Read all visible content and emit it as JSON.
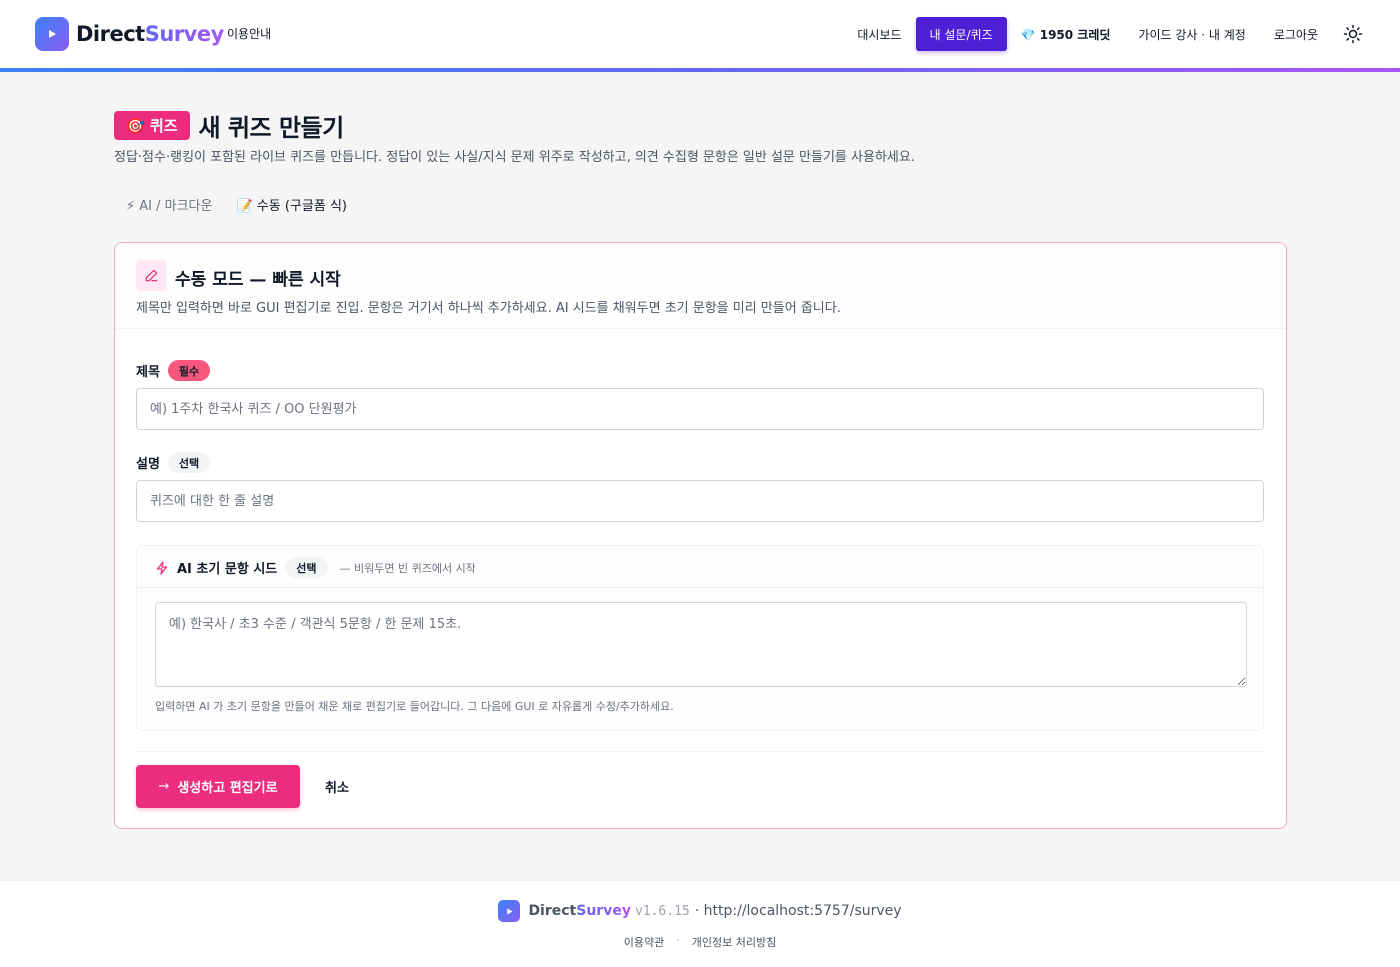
{
  "header": {
    "brand_part1": "Direct",
    "brand_part2": "Survey",
    "guide_link": "이용안내",
    "nav": {
      "dashboard": "대시보드",
      "my_surveys": "내 설문/퀴즈",
      "credits": "💎 1950 크레딧",
      "account": "가이드 강사 · 내 계정",
      "logout": "로그아웃"
    },
    "theme_icon": "sun-icon",
    "accent_color": "#4f1fd6"
  },
  "page": {
    "badge": "🎯 퀴즈",
    "title": "새 퀴즈 만들기",
    "description": "정답·점수·랭킹이 포함된 라이브 퀴즈를 만듭니다. 정답이 있는 사실/지식 문제 위주로 작성하고, 의견 수집형 문항은 일반 설문 만들기를 사용하세요.",
    "badge_color": "#ec2d7f"
  },
  "mode_tabs": {
    "ai": "⚡ AI / 마크다운",
    "manual": "📝 수동 (구글폼 식)"
  },
  "card": {
    "icon": "pencil-icon",
    "title": "수동 모드 — 빠른 시작",
    "description": "제목만 입력하면 바로 GUI 편집기로 진입. 문항은 거기서 하나씩 추가하세요. AI 시드를 채워두면 초기 문항을 미리 만들어 줍니다.",
    "title_field": {
      "label": "제목",
      "tag": "필수",
      "placeholder": "예) 1주차 한국사 퀴즈 / OO 단원평가",
      "value": ""
    },
    "desc_field": {
      "label": "설명",
      "tag": "선택",
      "placeholder": "퀴즈에 대한 한 줄 설명",
      "value": ""
    },
    "seed": {
      "icon": "lightning-icon",
      "label": "AI 초기 문항 시드",
      "tag": "선택",
      "hint": "— 비워두면 빈 퀴즈에서 시작",
      "placeholder": "예) 한국사 / 초3 수준 / 객관식 5문항 / 한 문제 15초.",
      "note": "입력하면 AI 가 초기 문항을 만들어 채운 채로 편집기로 들어갑니다. 그 다음에 GUI 로 자유롭게 수정/추가하세요."
    },
    "submit_label": "생성하고 편집기로",
    "cancel_label": "취소"
  },
  "footer": {
    "brand_part1": "Direct",
    "brand_part2": "Survey",
    "version": "v1.6.15",
    "url": "· http://localhost:5757/survey",
    "links": {
      "terms": "이용약관",
      "separator": "·",
      "privacy": "개인정보 처리방침"
    }
  }
}
